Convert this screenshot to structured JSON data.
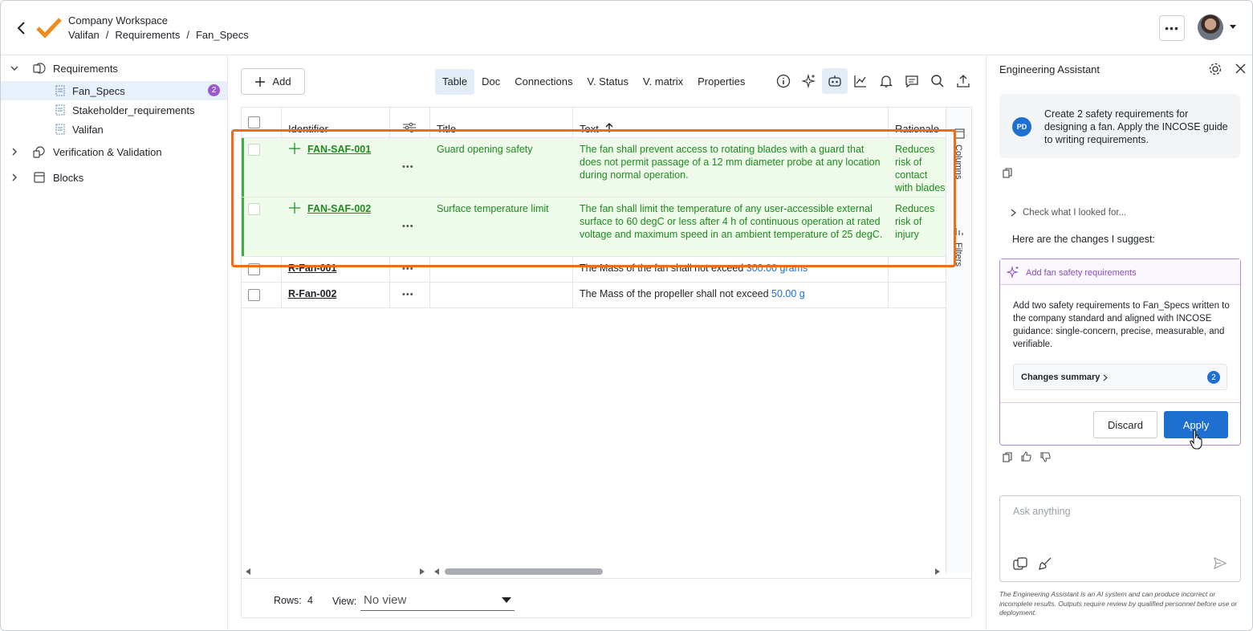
{
  "header": {
    "workspace": "Company Workspace",
    "breadcrumb": [
      "Valifan",
      "Requirements",
      "Fan_Specs"
    ],
    "separator": "/",
    "more_label": "•••"
  },
  "tree": {
    "items": [
      {
        "label": "Requirements",
        "level": 0,
        "expanded": true
      },
      {
        "label": "Fan_Specs",
        "level": 1,
        "selected": true,
        "badge": "2"
      },
      {
        "label": "Stakeholder_requirements",
        "level": 1
      },
      {
        "label": "Valifan",
        "level": 1
      },
      {
        "label": "Verification & Validation",
        "level": 0,
        "expanded": false
      },
      {
        "label": "Blocks",
        "level": 0,
        "expanded": false
      }
    ]
  },
  "toolbar": {
    "add_label": "Add",
    "tabs": [
      "Table",
      "Doc",
      "Connections",
      "V. Status",
      "V. matrix",
      "Properties"
    ],
    "active_tab": "Table",
    "icons": [
      "info-icon",
      "sparkle-icon",
      "robot-icon",
      "chart-icon",
      "bell-icon",
      "comment-icon",
      "search-icon",
      "export-icon"
    ]
  },
  "table": {
    "columns": [
      "Identifier",
      "Title",
      "Text",
      "Rationale"
    ],
    "sort_column": "Text",
    "rows": [
      {
        "id": "FAN-SAF-001",
        "new": true,
        "title": "Guard opening safety",
        "text": "The fan shall prevent access to rotating blades with a guard that does not permit passage of a 12 mm diameter probe at any location during normal operation.",
        "rationale": "Reduces risk of contact with blades during use."
      },
      {
        "id": "FAN-SAF-002",
        "new": true,
        "title": "Surface temperature limit",
        "text": "The fan shall limit the temperature of any user-accessible external surface to 60 degC or less after 4 h of continuous operation at rated voltage and maximum speed in an ambient temperature of 25 degC.",
        "rationale": "Reduces risk of injury during intended op"
      },
      {
        "id": "R-Fan-001",
        "new": false,
        "title": "",
        "text": "The Mass of the fan shall not exceed",
        "value": "300.00",
        "unit": "grams",
        "rationale": ""
      },
      {
        "id": "R-Fan-002",
        "new": false,
        "title": "",
        "text": "The Mass of the propeller shall not exceed",
        "value": "50.00",
        "unit": "g",
        "rationale": ""
      }
    ],
    "side_labels": [
      "Columns",
      "Filters"
    ],
    "footer": {
      "rows_label": "Rows:",
      "rows_value": "4",
      "view_label": "View:",
      "view_value": "No view"
    }
  },
  "assistant": {
    "title": "Engineering Assistant",
    "user_initials": "PD",
    "user_message": "Create 2 safety requirements for designing a fan. Apply the INCOSE guide to writing requirements.",
    "check_label": "Check what I looked for...",
    "suggest_label": "Here are the changes I suggest:",
    "card": {
      "title": "Add fan safety requirements",
      "body": "Add two safety requirements to Fan_Specs written to the company standard and aligned with INCOSE guidance: single-concern, precise, measurable, and verifiable.",
      "summary_label": "Changes summary",
      "summary_count": "2",
      "discard_label": "Discard",
      "apply_label": "Apply"
    },
    "input_placeholder": "Ask anything",
    "disclaimer": "The Engineering Assistant is an AI system and can produce incorrect or incomplete results. Outputs require review by qualified personnel before use or deployment."
  },
  "colors": {
    "accent": "#1f6fd1",
    "new_row_bg": "#eefaea",
    "new_row_text": "#1e8c1e",
    "highlight": "#ef6c1a",
    "card_border": "#b48bd8",
    "logo": "#f08a1c"
  }
}
